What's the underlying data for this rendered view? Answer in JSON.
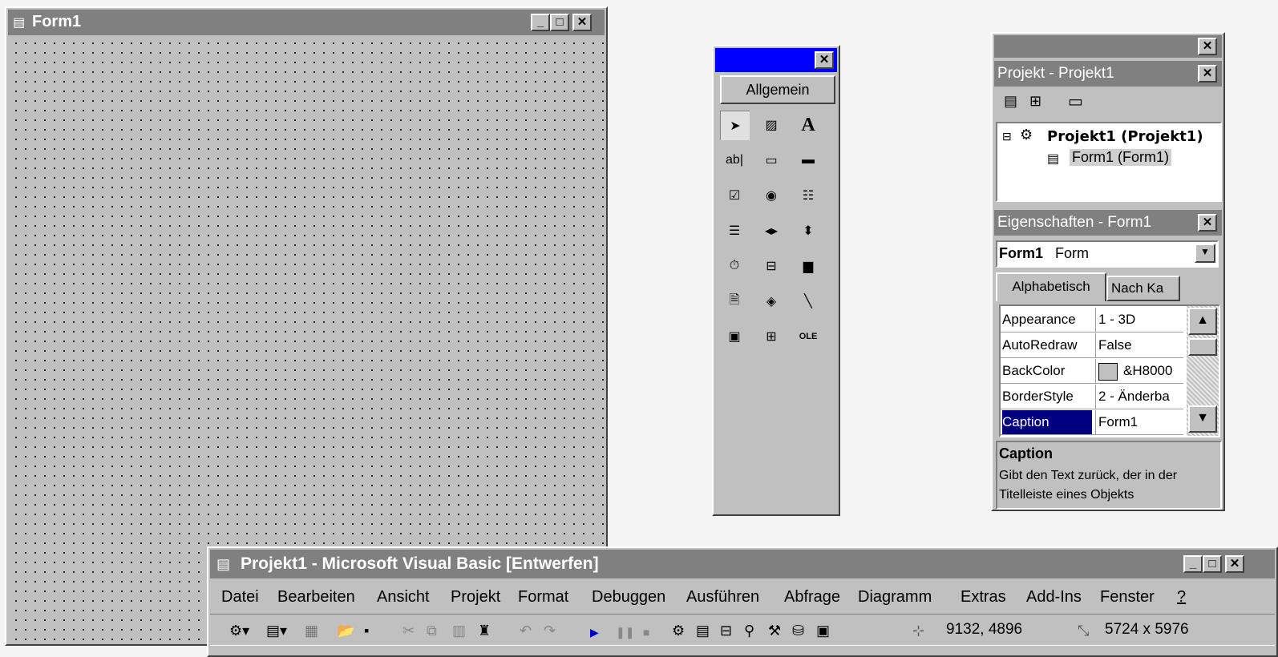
{
  "form": {
    "title": "Form1"
  },
  "toolbox": {
    "group_label": "Allgemein",
    "tools": [
      {
        "icon": "pointer-icon",
        "glyph": "➤"
      },
      {
        "icon": "picturebox-icon",
        "glyph": "▨"
      },
      {
        "icon": "label-icon",
        "glyph": "A"
      },
      {
        "icon": "textbox-icon",
        "glyph": "ab|"
      },
      {
        "icon": "frame-icon",
        "glyph": "▭"
      },
      {
        "icon": "commandbutton-icon",
        "glyph": "▬"
      },
      {
        "icon": "checkbox-icon",
        "glyph": "☑"
      },
      {
        "icon": "optionbutton-icon",
        "glyph": "◉"
      },
      {
        "icon": "combobox-icon",
        "glyph": "☷"
      },
      {
        "icon": "listbox-icon",
        "glyph": "☰"
      },
      {
        "icon": "hscrollbar-icon",
        "glyph": "◂▸"
      },
      {
        "icon": "vscrollbar-icon",
        "glyph": "⬍"
      },
      {
        "icon": "timer-icon",
        "glyph": "⏱"
      },
      {
        "icon": "drivelistbox-icon",
        "glyph": "⊟"
      },
      {
        "icon": "dirlistbox-icon",
        "glyph": "▆"
      },
      {
        "icon": "filelistbox-icon",
        "glyph": "🗎"
      },
      {
        "icon": "shape-icon",
        "glyph": "◈"
      },
      {
        "icon": "line-icon",
        "glyph": "╲"
      },
      {
        "icon": "image-icon",
        "glyph": "▣"
      },
      {
        "icon": "data-icon",
        "glyph": "⊞"
      },
      {
        "icon": "ole-icon",
        "glyph": "OLE"
      }
    ]
  },
  "project": {
    "title": "Projekt - Projekt1",
    "root": "Projekt1 (Projekt1)",
    "child": "Form1 (Form1)"
  },
  "properties": {
    "title": "Eigenschaften - Form1",
    "object_name": "Form1",
    "object_type": "Form",
    "tab_alpha": "Alphabetisch",
    "tab_cat": "Nach Ka",
    "rows": [
      {
        "name": "Appearance",
        "value": "1 - 3D"
      },
      {
        "name": "AutoRedraw",
        "value": "False"
      },
      {
        "name": "BackColor",
        "value": "&H8000"
      },
      {
        "name": "BorderStyle",
        "value": "2 - Änderba"
      },
      {
        "name": "Caption",
        "value": "Form1"
      }
    ],
    "desc_title": "Caption",
    "desc_text": "Gibt den Text zurück, der in der Titelleiste eines Objekts"
  },
  "ide": {
    "title": "Projekt1 - Microsoft Visual Basic [Entwerfen]",
    "menu": [
      "Datei",
      "Bearbeiten",
      "Ansicht",
      "Projekt",
      "Format",
      "Debuggen",
      "Ausführen",
      "Abfrage",
      "Diagramm",
      "Extras",
      "Add-Ins",
      "Fenster",
      "?"
    ],
    "position": "9132, 4896",
    "size": "5724 x 5976"
  },
  "colors": {
    "face": "#c0c0c0",
    "caption_inactive": "#808080",
    "caption_active": "#0000ff",
    "selection": "#000080"
  }
}
